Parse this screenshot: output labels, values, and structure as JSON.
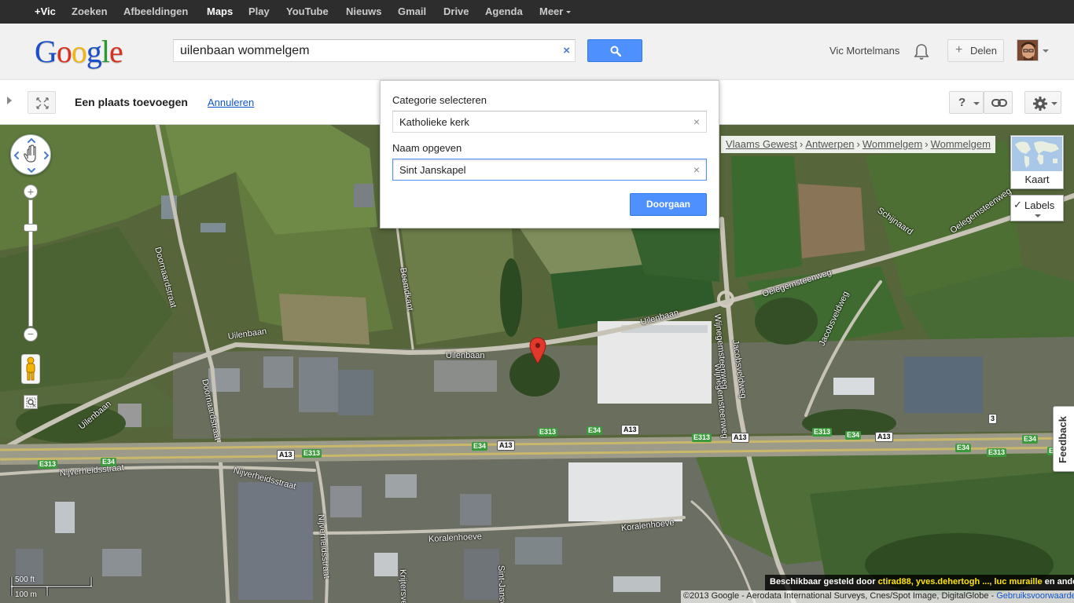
{
  "topbar": {
    "items": [
      "+Vic",
      "Zoeken",
      "Afbeeldingen",
      "Maps",
      "Play",
      "YouTube",
      "Nieuws",
      "Gmail",
      "Drive",
      "Agenda",
      "Meer"
    ]
  },
  "header": {
    "logo_letters": [
      "G",
      "o",
      "o",
      "g",
      "l",
      "e"
    ],
    "search_value": "uilenbaan wommelgem",
    "search_clear": "×",
    "user_name": "Vic Mortelmans",
    "share_plus": "+",
    "share_label": "Delen"
  },
  "toolbar": {
    "title": "Een plaats toevoegen",
    "cancel": "Annuleren",
    "help": "?"
  },
  "dialog": {
    "category_label": "Categorie selecteren",
    "category_value": "Katholieke kerk",
    "name_label": "Naam opgeven",
    "name_value": "Sint Janskapel",
    "clear_symbol": "×",
    "submit": "Doorgaan"
  },
  "map": {
    "breadcrumb": [
      "Vlaams Gewest",
      "Antwerpen",
      "Wommelgem",
      "Wommelgem"
    ],
    "breadcrumb_sep": "›",
    "map_type": "Kaart",
    "labels": "Labels",
    "labels_check": "✓",
    "zoom_in": "+",
    "zoom_out": "−",
    "feedback": "Feedback",
    "scale": {
      "top": "500 ft",
      "bottom": "100 m"
    },
    "streets": [
      "Uilenbaan",
      "Uilenbaan",
      "Uilenbaan",
      "Uilenbaan",
      "Doornaardstraat",
      "Doornaardstraat",
      "Beemdkant",
      "Nijverheidsstraat",
      "Nijverheidsstraat",
      "Nijverheidsstraat",
      "Koralenhoeve",
      "Koralenhoeve",
      "Wijnegemsteenweg",
      "Wijnegemsteenweg",
      "Jacobsveldweg",
      "Jacobsveldweg",
      "Oelegemsteenweg",
      "Oelegemsteenweg",
      "Schijnaard",
      "Krijtersveld",
      "Sint-Jansv"
    ],
    "shields": [
      "E313",
      "E34",
      "A13",
      "E313",
      "E34",
      "A13",
      "E313",
      "A13",
      "E34",
      "E313",
      "E34",
      "A13",
      "E313",
      "E313",
      "E34",
      "A13",
      "E34",
      "E313",
      "3"
    ],
    "contrib_prefix": "Beschikbaar gesteld door",
    "contrib_users": "ctirad88, yves.dehertogh ..., luc muraille",
    "contrib_suffix": "en anderen",
    "copyright": "©2013 Google - Aerodata International Surveys, Cnes/Spot Image, DigitalGlobe -",
    "terms": "Gebruiksvoorwaarden"
  },
  "colors": {
    "accent_blue": "#4d90fe",
    "link_blue": "#1155cc",
    "marker_red": "#e2382c",
    "logo": [
      "#1a4fc9",
      "#d8321f",
      "#f2b50f",
      "#1a4fc9",
      "#2a9a32",
      "#d8321f"
    ]
  },
  "icons": [
    "search-icon",
    "bell-icon",
    "link-icon",
    "gear-icon",
    "expand-icon",
    "pan-icon",
    "pegman-icon",
    "marker-icon"
  ]
}
